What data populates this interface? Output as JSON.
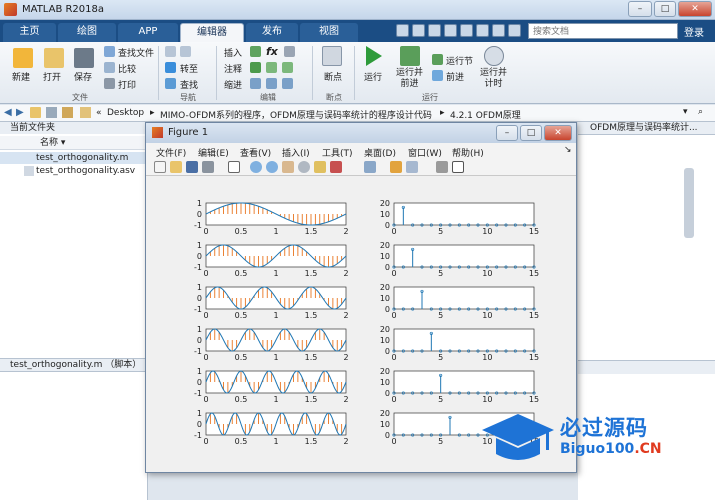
{
  "window": {
    "title": "MATLAB R2018a"
  },
  "tabs": [
    {
      "label": "主页"
    },
    {
      "label": "绘图"
    },
    {
      "label": "APP"
    },
    {
      "label": "编辑器"
    },
    {
      "label": "发布"
    },
    {
      "label": "视图"
    }
  ],
  "search": {
    "placeholder": "搜索文档"
  },
  "login": "登录",
  "ribbon": {
    "file": {
      "new": "新建",
      "open": "打开",
      "save": "保存",
      "find_files": "查找文件",
      "compare": "比较",
      "print": "打印",
      "group": "文件"
    },
    "navigate": {
      "goto": "转至",
      "find": "查找",
      "group": "导航"
    },
    "edit": {
      "insert": "插入",
      "comment": "注释",
      "indent": "缩进",
      "fx": "fx",
      "group": "编辑"
    },
    "breakpoints": {
      "label": "断点",
      "group": "断点"
    },
    "run": {
      "run": "运行",
      "run_advance": "运行并\n前进",
      "run_section": "运行节",
      "advance": "前进",
      "run_time": "运行并\n计时",
      "group": "运行"
    }
  },
  "address": {
    "path": [
      "«",
      "Desktop",
      "MIMO-OFDM系列的程序，OFDM原理与误码率统计的程序设计代码",
      "4.2.1 OFDM原理"
    ]
  },
  "current_folder": {
    "title": "当前文件夹",
    "column": "名称",
    "files": [
      "test_orthogonality.m",
      "test_orthogonality.asv"
    ],
    "details": "test_orthogonality.m （脚本）"
  },
  "right_panel_text": "OFDM原理与误码率统计...",
  "figure": {
    "title": "Figure 1",
    "menu": [
      "文件(F)",
      "编辑(E)",
      "查看(V)",
      "插入(I)",
      "工具(T)",
      "桌面(D)",
      "窗口(W)",
      "帮助(H)"
    ]
  },
  "chart_data": [
    {
      "type": "line",
      "subplot": "left",
      "rows": 6,
      "xlim": [
        0,
        2
      ],
      "ylim": [
        -1,
        1
      ],
      "xticks": [
        "0",
        "0.5",
        "1",
        "1.5",
        "2"
      ],
      "yticks": [
        "1",
        "0",
        "-1"
      ],
      "series": [
        {
          "cycles": 1
        },
        {
          "cycles": 2
        },
        {
          "cycles": 3
        },
        {
          "cycles": 4
        },
        {
          "cycles": 5
        },
        {
          "cycles": 6
        }
      ],
      "colors": {
        "line": "#1f77b4",
        "stem": "#e8741e"
      }
    },
    {
      "type": "stem",
      "subplot": "right",
      "rows": 6,
      "xlim": [
        0,
        15
      ],
      "xticks": [
        "0",
        "5",
        "10",
        "15"
      ],
      "series": [
        {
          "ylim": [
            0,
            20
          ],
          "yticks": [
            "20",
            "10",
            "0"
          ],
          "peak_x": 1,
          "peak_y": 16
        },
        {
          "ylim": [
            0,
            20
          ],
          "yticks": [
            "20",
            "10",
            "0"
          ],
          "peak_x": 2,
          "peak_y": 16
        },
        {
          "ylim": [
            0,
            20
          ],
          "yticks": [
            "20",
            "10",
            "0"
          ],
          "peak_x": 3,
          "peak_y": 16
        },
        {
          "ylim": [
            0,
            20
          ],
          "yticks": [
            "20",
            "10",
            "0"
          ],
          "peak_x": 4,
          "peak_y": 16
        },
        {
          "ylim": [
            0,
            20
          ],
          "yticks": [
            "20",
            "10",
            "0"
          ],
          "peak_x": 5,
          "peak_y": 16
        },
        {
          "ylim": [
            0,
            20
          ],
          "yticks": [
            "20",
            "10",
            "0"
          ],
          "peak_x": 6,
          "peak_y": 16
        }
      ],
      "colors": {
        "stem": "#1f77b4"
      }
    }
  ],
  "watermark": {
    "cn": "必过源码",
    "site": "Biguo100",
    "tld": ".CN"
  }
}
